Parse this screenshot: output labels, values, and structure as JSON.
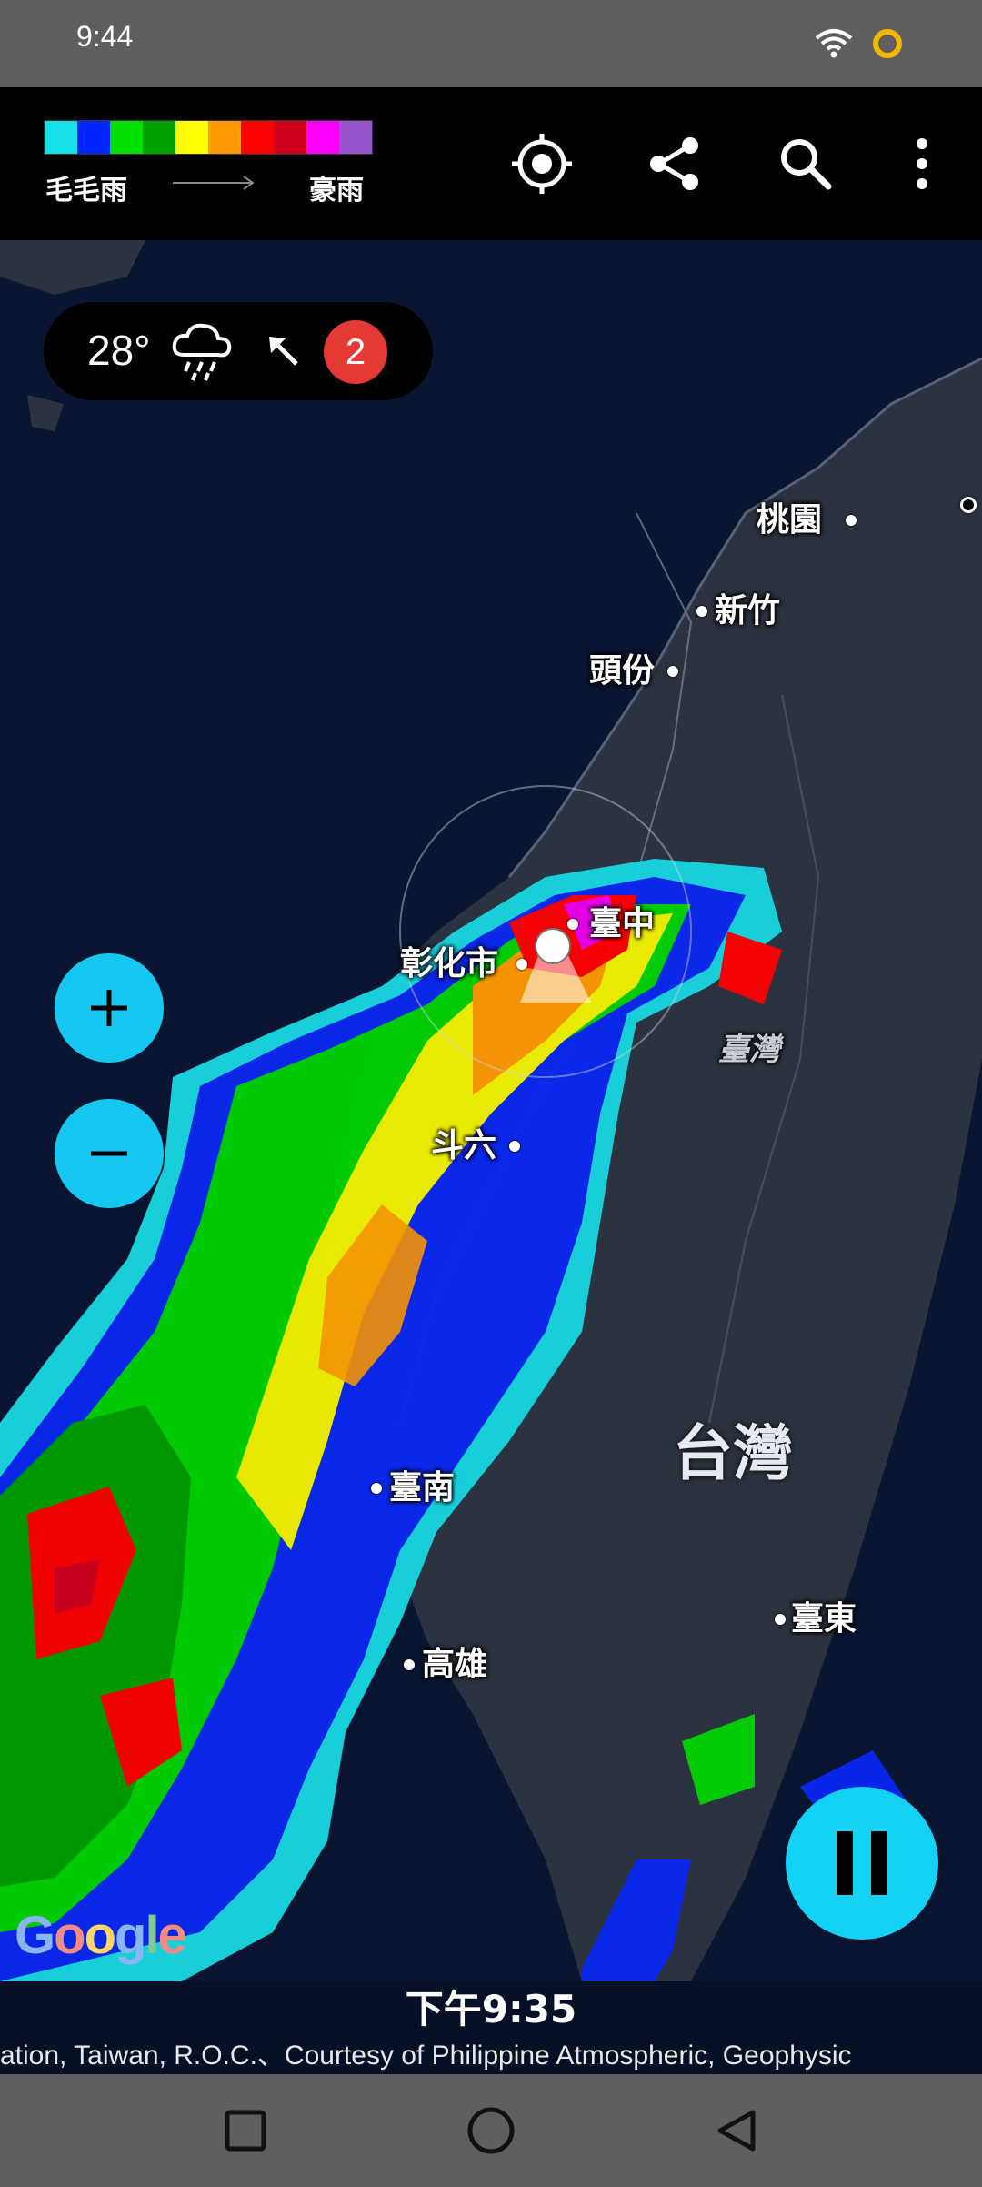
{
  "status_bar": {
    "time": "9:44",
    "icons": [
      "wifi-icon",
      "ring-status-icon"
    ]
  },
  "legend": {
    "min_label": "毛毛雨",
    "max_label": "豪雨",
    "colors": [
      "#18e0e8",
      "#0026ff",
      "#00e000",
      "#00a000",
      "#ffff00",
      "#ff9900",
      "#ff0000",
      "#d0001a",
      "#ff00ff",
      "#9955cc"
    ]
  },
  "toolbar": {
    "buttons": [
      "locate-icon",
      "share-icon",
      "search-icon",
      "more-vert-icon"
    ]
  },
  "weather": {
    "temperature": "28°",
    "condition_icon": "rain-cloud-icon",
    "wind_icon": "arrow-northwest-icon",
    "alert_count": "2"
  },
  "map": {
    "cities": {
      "taoyuan": "桃園",
      "hsinchu": "新竹",
      "toufen": "頭份",
      "taichung": "臺中",
      "changhua": "彰化市",
      "taiwan_small": "臺灣",
      "douliu": "斗六",
      "taiwan_big": "台灣",
      "tainan": "臺南",
      "kaohsiung": "高雄",
      "taitung": "臺東"
    },
    "google_logo": "Google"
  },
  "controls": {
    "zoom_in": "+",
    "zoom_out": "−"
  },
  "timestamp": "下午9:35",
  "credits": "ation, Taiwan, R.O.C.、Courtesy of Philippine Atmospheric, Geophysic",
  "nav": [
    "recents-square-icon",
    "home-circle-icon",
    "back-triangle-icon"
  ]
}
